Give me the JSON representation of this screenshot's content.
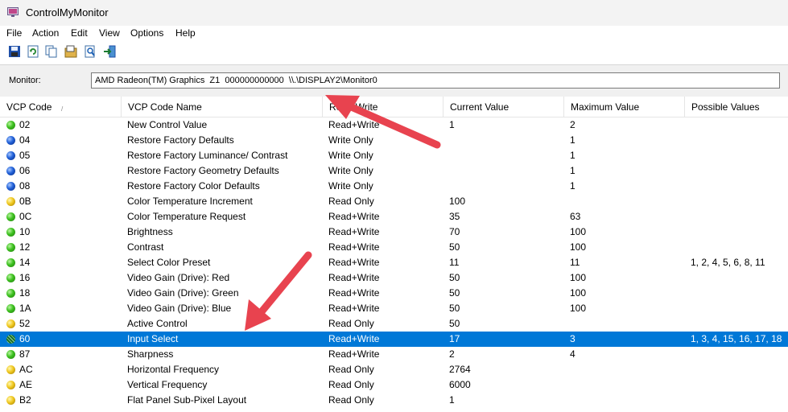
{
  "window": {
    "title": "ControlMyMonitor"
  },
  "menu": [
    "File",
    "Action",
    "Edit",
    "View",
    "Options",
    "Help"
  ],
  "toolbar": [
    "save-icon",
    "refresh-icon",
    "copy-icon",
    "properties-icon",
    "find-icon",
    "exit-icon"
  ],
  "monitor": {
    "label": "Monitor:",
    "value": "AMD Radeon(TM) Graphics  Z1  000000000000  \\\\.\\DISPLAY2\\Monitor0"
  },
  "columns": [
    "VCP Code",
    "VCP Code Name",
    "Read-Write",
    "Current Value",
    "Maximum Value",
    "Possible Values"
  ],
  "rows": [
    {
      "status": "green",
      "code": "02",
      "name": "New Control Value",
      "rw": "Read+Write",
      "cur": "1",
      "max": "2",
      "poss": ""
    },
    {
      "status": "blue",
      "code": "04",
      "name": "Restore Factory Defaults",
      "rw": "Write Only",
      "cur": "",
      "max": "1",
      "poss": ""
    },
    {
      "status": "blue",
      "code": "05",
      "name": "Restore Factory Luminance/ Contrast",
      "rw": "Write Only",
      "cur": "",
      "max": "1",
      "poss": ""
    },
    {
      "status": "blue",
      "code": "06",
      "name": "Restore Factory Geometry Defaults",
      "rw": "Write Only",
      "cur": "",
      "max": "1",
      "poss": ""
    },
    {
      "status": "blue",
      "code": "08",
      "name": "Restore Factory Color Defaults",
      "rw": "Write Only",
      "cur": "",
      "max": "1",
      "poss": ""
    },
    {
      "status": "yellow",
      "code": "0B",
      "name": "Color Temperature Increment",
      "rw": "Read Only",
      "cur": "100",
      "max": "",
      "poss": ""
    },
    {
      "status": "green",
      "code": "0C",
      "name": "Color Temperature Request",
      "rw": "Read+Write",
      "cur": "35",
      "max": "63",
      "poss": ""
    },
    {
      "status": "green",
      "code": "10",
      "name": "Brightness",
      "rw": "Read+Write",
      "cur": "70",
      "max": "100",
      "poss": ""
    },
    {
      "status": "green",
      "code": "12",
      "name": "Contrast",
      "rw": "Read+Write",
      "cur": "50",
      "max": "100",
      "poss": ""
    },
    {
      "status": "green",
      "code": "14",
      "name": "Select Color Preset",
      "rw": "Read+Write",
      "cur": "11",
      "max": "11",
      "poss": "1, 2, 4, 5, 6, 8, 11"
    },
    {
      "status": "green",
      "code": "16",
      "name": "Video Gain (Drive): Red",
      "rw": "Read+Write",
      "cur": "50",
      "max": "100",
      "poss": ""
    },
    {
      "status": "green",
      "code": "18",
      "name": "Video Gain (Drive): Green",
      "rw": "Read+Write",
      "cur": "50",
      "max": "100",
      "poss": ""
    },
    {
      "status": "green",
      "code": "1A",
      "name": "Video Gain (Drive): Blue",
      "rw": "Read+Write",
      "cur": "50",
      "max": "100",
      "poss": ""
    },
    {
      "status": "yellow",
      "code": "52",
      "name": "Active Control",
      "rw": "Read Only",
      "cur": "50",
      "max": "",
      "poss": ""
    },
    {
      "status": "selected",
      "code": "60",
      "name": "Input Select",
      "rw": "Read+Write",
      "cur": "17",
      "max": "3",
      "poss": "1, 3, 4, 15, 16, 17, 18"
    },
    {
      "status": "green",
      "code": "87",
      "name": "Sharpness",
      "rw": "Read+Write",
      "cur": "2",
      "max": "4",
      "poss": ""
    },
    {
      "status": "yellow",
      "code": "AC",
      "name": "Horizontal Frequency",
      "rw": "Read Only",
      "cur": "2764",
      "max": "",
      "poss": ""
    },
    {
      "status": "yellow",
      "code": "AE",
      "name": "Vertical Frequency",
      "rw": "Read Only",
      "cur": "6000",
      "max": "",
      "poss": ""
    },
    {
      "status": "yellow",
      "code": "B2",
      "name": "Flat Panel Sub-Pixel Layout",
      "rw": "Read Only",
      "cur": "1",
      "max": "",
      "poss": ""
    }
  ],
  "selected_row": 14,
  "colors": {
    "selection": "#0078d7",
    "annotation_arrow": "#e8434f"
  }
}
